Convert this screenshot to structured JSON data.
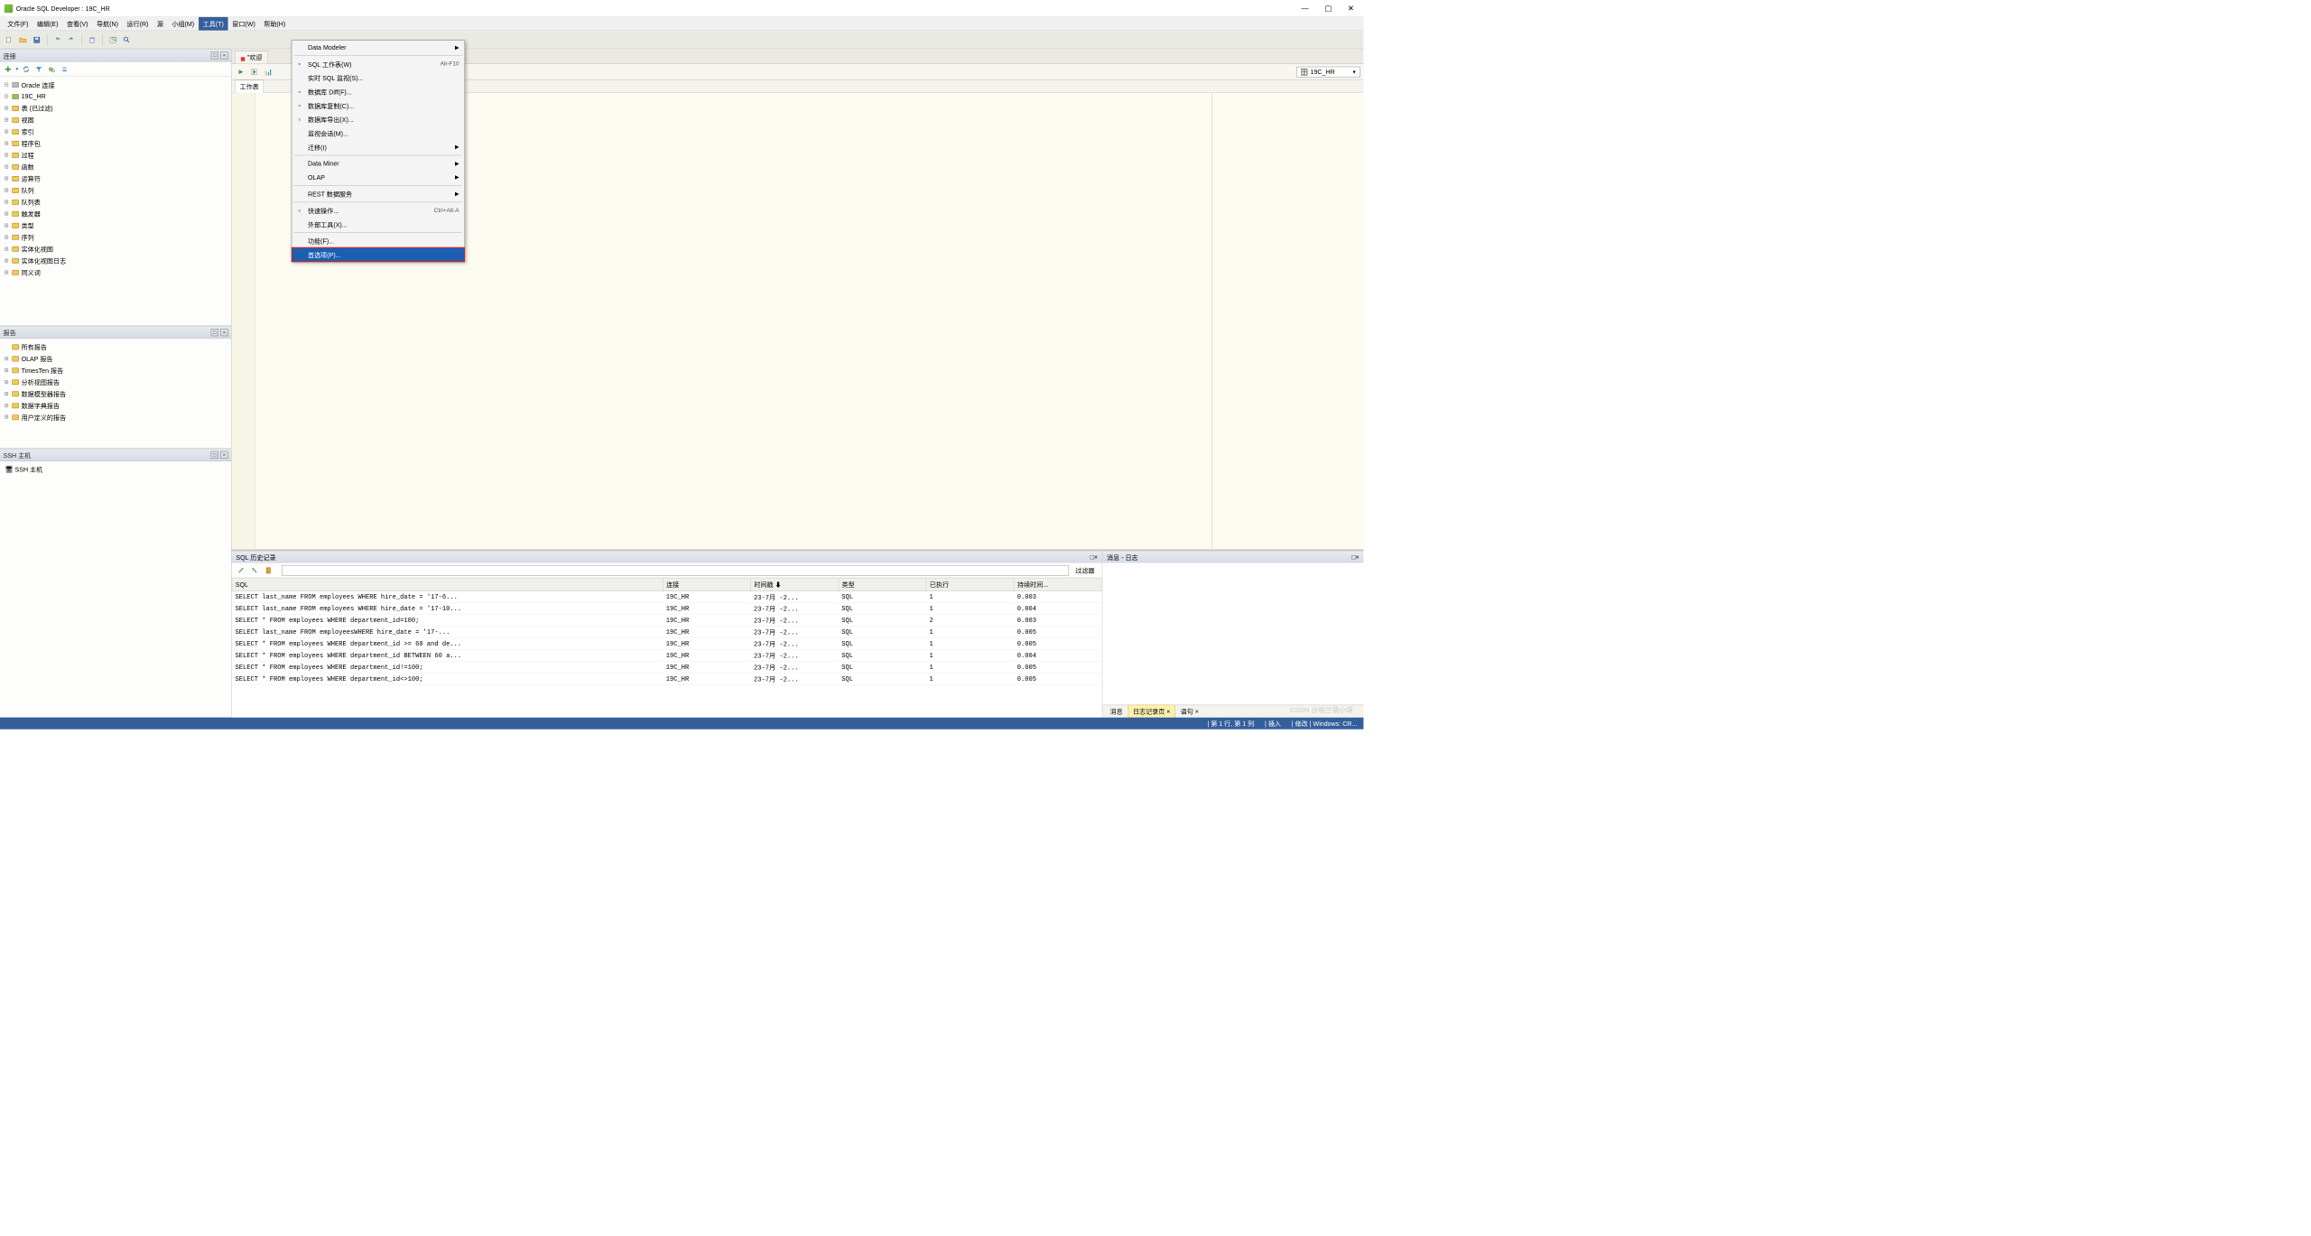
{
  "window": {
    "title": "Oracle SQL Developer : 19C_HR"
  },
  "menubar": {
    "items": [
      "文件(F)",
      "编辑(E)",
      "查看(V)",
      "导航(N)",
      "运行(R)",
      "源",
      "小组(M)",
      "工具(T)",
      "窗口(W)",
      "帮助(H)"
    ],
    "active_index": 7
  },
  "dropdown": {
    "items": [
      {
        "label": "Data Modeler",
        "arrow": true
      },
      {
        "sep": true
      },
      {
        "label": "SQL 工作表(W)",
        "accel": "Alt-F10",
        "icon": "sql"
      },
      {
        "label": "实时 SQL 监视(S)..."
      },
      {
        "label": "数据库 Diff(F)...",
        "icon": "diff"
      },
      {
        "label": "数据库复制(C)...",
        "icon": "copy"
      },
      {
        "label": "数据库导出(X)...",
        "icon": "export"
      },
      {
        "label": "监视会话(M)..."
      },
      {
        "label": "迁移(I)",
        "arrow": true
      },
      {
        "sep": true
      },
      {
        "label": "Data Miner",
        "arrow": true
      },
      {
        "label": "OLAP",
        "arrow": true
      },
      {
        "sep": true
      },
      {
        "label": "REST 数据服务",
        "arrow": true
      },
      {
        "sep": true
      },
      {
        "label": "快速操作...",
        "accel": "Ctrl+Alt-A",
        "icon": "quick"
      },
      {
        "label": "外部工具(X)..."
      },
      {
        "sep": true
      },
      {
        "label": "功能(F)..."
      },
      {
        "label": "首选项(P)...",
        "highlight": true
      }
    ]
  },
  "connections": {
    "title": "连接",
    "root": "Oracle 连接",
    "db": "19C_HR",
    "nodes": [
      "表  (已过滤)",
      "视图",
      "索引",
      "程序包",
      "过程",
      "函数",
      "运算符",
      "队列",
      "队列表",
      "触发器",
      "类型",
      "序列",
      "实体化视图",
      "实体化视图日志",
      "同义词"
    ]
  },
  "reports": {
    "title": "报告",
    "root": "所有报告",
    "items": [
      "OLAP 报告",
      "TimesTen 报告",
      "分析视图报告",
      "数据模型器报告",
      "数据字典报告",
      "用户定义的报告"
    ]
  },
  "ssh": {
    "title": "SSH 主机",
    "root": "SSH 主机"
  },
  "editor": {
    "tabs": [
      {
        "label": "\"欢迎"
      },
      {
        "label": ""
      }
    ],
    "subtab": "工作表",
    "conn": "19C_HR"
  },
  "history": {
    "title": "SQL 历史记录",
    "filter_label": "过滤器",
    "cols": [
      "SQL",
      "连接",
      "时间戳 ⬇",
      "类型",
      "已执行",
      "持续时间..."
    ],
    "rows": [
      {
        "sql": "SELECT last_name FROM employees WHERE hire_date = '17-6...",
        "conn": "19C_HR",
        "ts": "23-7月 -2...",
        "type": "SQL",
        "exec": "1",
        "dur": "0.003"
      },
      {
        "sql": "SELECT last_name FROM employees WHERE hire_date = '17-10...",
        "conn": "19C_HR",
        "ts": "23-7月 -2...",
        "type": "SQL",
        "exec": "1",
        "dur": "0.004"
      },
      {
        "sql": "SELECT * FROM employees WHERE department_id=100;",
        "conn": "19C_HR",
        "ts": "23-7月 -2...",
        "type": "SQL",
        "exec": "2",
        "dur": "0.003"
      },
      {
        "sql": "SELECT last_name FROM   employeesWHERE   hire_date = '17-...",
        "conn": "19C_HR",
        "ts": "23-7月 -2...",
        "type": "SQL",
        "exec": "1",
        "dur": "0.005"
      },
      {
        "sql": "SELECT * FROM employees WHERE department_id >= 60 and de...",
        "conn": "19C_HR",
        "ts": "23-7月 -2...",
        "type": "SQL",
        "exec": "1",
        "dur": "0.005"
      },
      {
        "sql": "SELECT * FROM employees WHERE department_id BETWEEN 60 a...",
        "conn": "19C_HR",
        "ts": "23-7月 -2...",
        "type": "SQL",
        "exec": "1",
        "dur": "0.004"
      },
      {
        "sql": "SELECT * FROM employees WHERE department_id!=100;",
        "conn": "19C_HR",
        "ts": "23-7月 -2...",
        "type": "SQL",
        "exec": "1",
        "dur": "0.005"
      },
      {
        "sql": "SELECT * FROM employees WHERE department_id<>100;",
        "conn": "19C_HR",
        "ts": "23-7月 -2...",
        "type": "SQL",
        "exec": "1",
        "dur": "0.005"
      }
    ]
  },
  "messages": {
    "title": "消息 - 日志",
    "tabs": [
      "消息",
      "日志记录页 ×",
      "语句 ×"
    ],
    "active": 1
  },
  "status": {
    "pos": "| 第 1 行, 第 1 列",
    "mode": "| 插入",
    "user": "| 修改 | Windows: CR..."
  },
  "watermark": "CSDN @格兰德小琪"
}
